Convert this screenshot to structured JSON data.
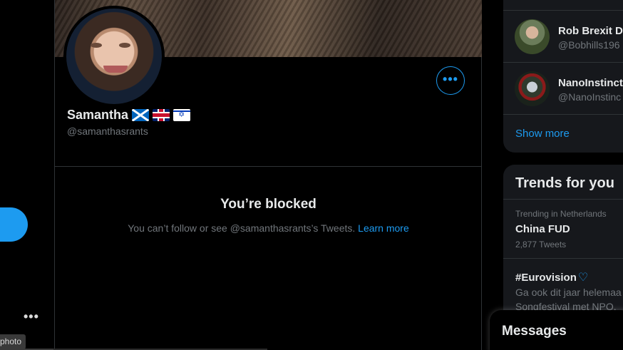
{
  "nav": {
    "more_dots": "•••",
    "tooltip": "photo"
  },
  "profile": {
    "name": "Samantha",
    "flags": [
      "scotland-flag-icon",
      "uk-flag-icon",
      "israel-flag-icon"
    ],
    "handle": "@samanthasrants",
    "more_button": "•••"
  },
  "blocked": {
    "title": "You’re blocked",
    "message": "You can’t follow or see @samanthasrants’s Tweets.",
    "link": "Learn more"
  },
  "who_to_follow": {
    "items": [
      {
        "name": "Rob Brexit Do",
        "handle": "@Bobhills196"
      },
      {
        "name": "NanoInstinct",
        "handle": "@NanoInstinc"
      }
    ],
    "show_more": "Show more"
  },
  "trends": {
    "title": "Trends for you",
    "items": [
      {
        "meta": "Trending in Netherlands",
        "name": "China FUD",
        "count": "2,877 Tweets"
      },
      {
        "name": "#Eurovision",
        "text_line1": "Ga ook dit jaar helemaa",
        "text_line2": "Songfestival met NPO."
      }
    ]
  },
  "messages": {
    "label": "Messages"
  },
  "colors": {
    "accent": "#1d9bf0",
    "background": "#000000",
    "panel": "#16181c",
    "muted_text": "#71767b"
  }
}
